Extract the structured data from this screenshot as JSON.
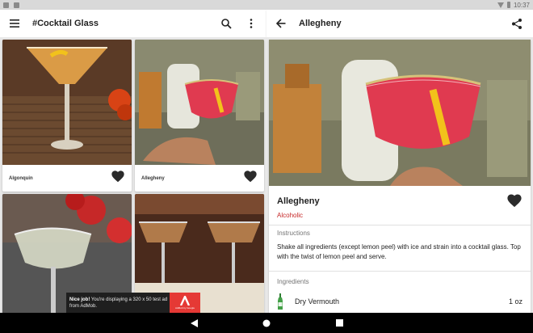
{
  "status_bar": {
    "time": "10:37"
  },
  "list_toolbar": {
    "title": "#Cocktail Glass"
  },
  "grid": {
    "cards": [
      {
        "name": "Algonquin"
      },
      {
        "name": "Allegheny"
      },
      {
        "name": ""
      },
      {
        "name": ""
      }
    ]
  },
  "detail": {
    "toolbar_title": "Allegheny",
    "title": "Allegheny",
    "alcoholic": "Alcoholic",
    "instructions_label": "Instructions",
    "instructions": "Shake all ingredients (except lemon peel) with ice and strain into a cocktail glass. Top with the twist of lemon peel and serve.",
    "ingredients_label": "Ingredients",
    "ingredients": [
      {
        "name": "Dry Vermouth",
        "amount": "1 oz"
      }
    ]
  },
  "ad": {
    "bold": "Nice job!",
    "text": " You're displaying a 320 x 50 test ad from AdMob.",
    "logo_caption": "AdMob by Google"
  },
  "colors": {
    "accent": "#c62828",
    "toolbar_bg": "#ffffff",
    "nav_bg": "#000000",
    "ad_bg": "#1f1f1f",
    "ad_logo": "#e53935"
  },
  "icons": {
    "menu": "menu-icon",
    "search": "search-icon",
    "overflow": "more-vert-icon",
    "back": "arrow-back-icon",
    "share": "share-icon",
    "favorite": "heart-icon",
    "bottle": "bottle-icon"
  }
}
